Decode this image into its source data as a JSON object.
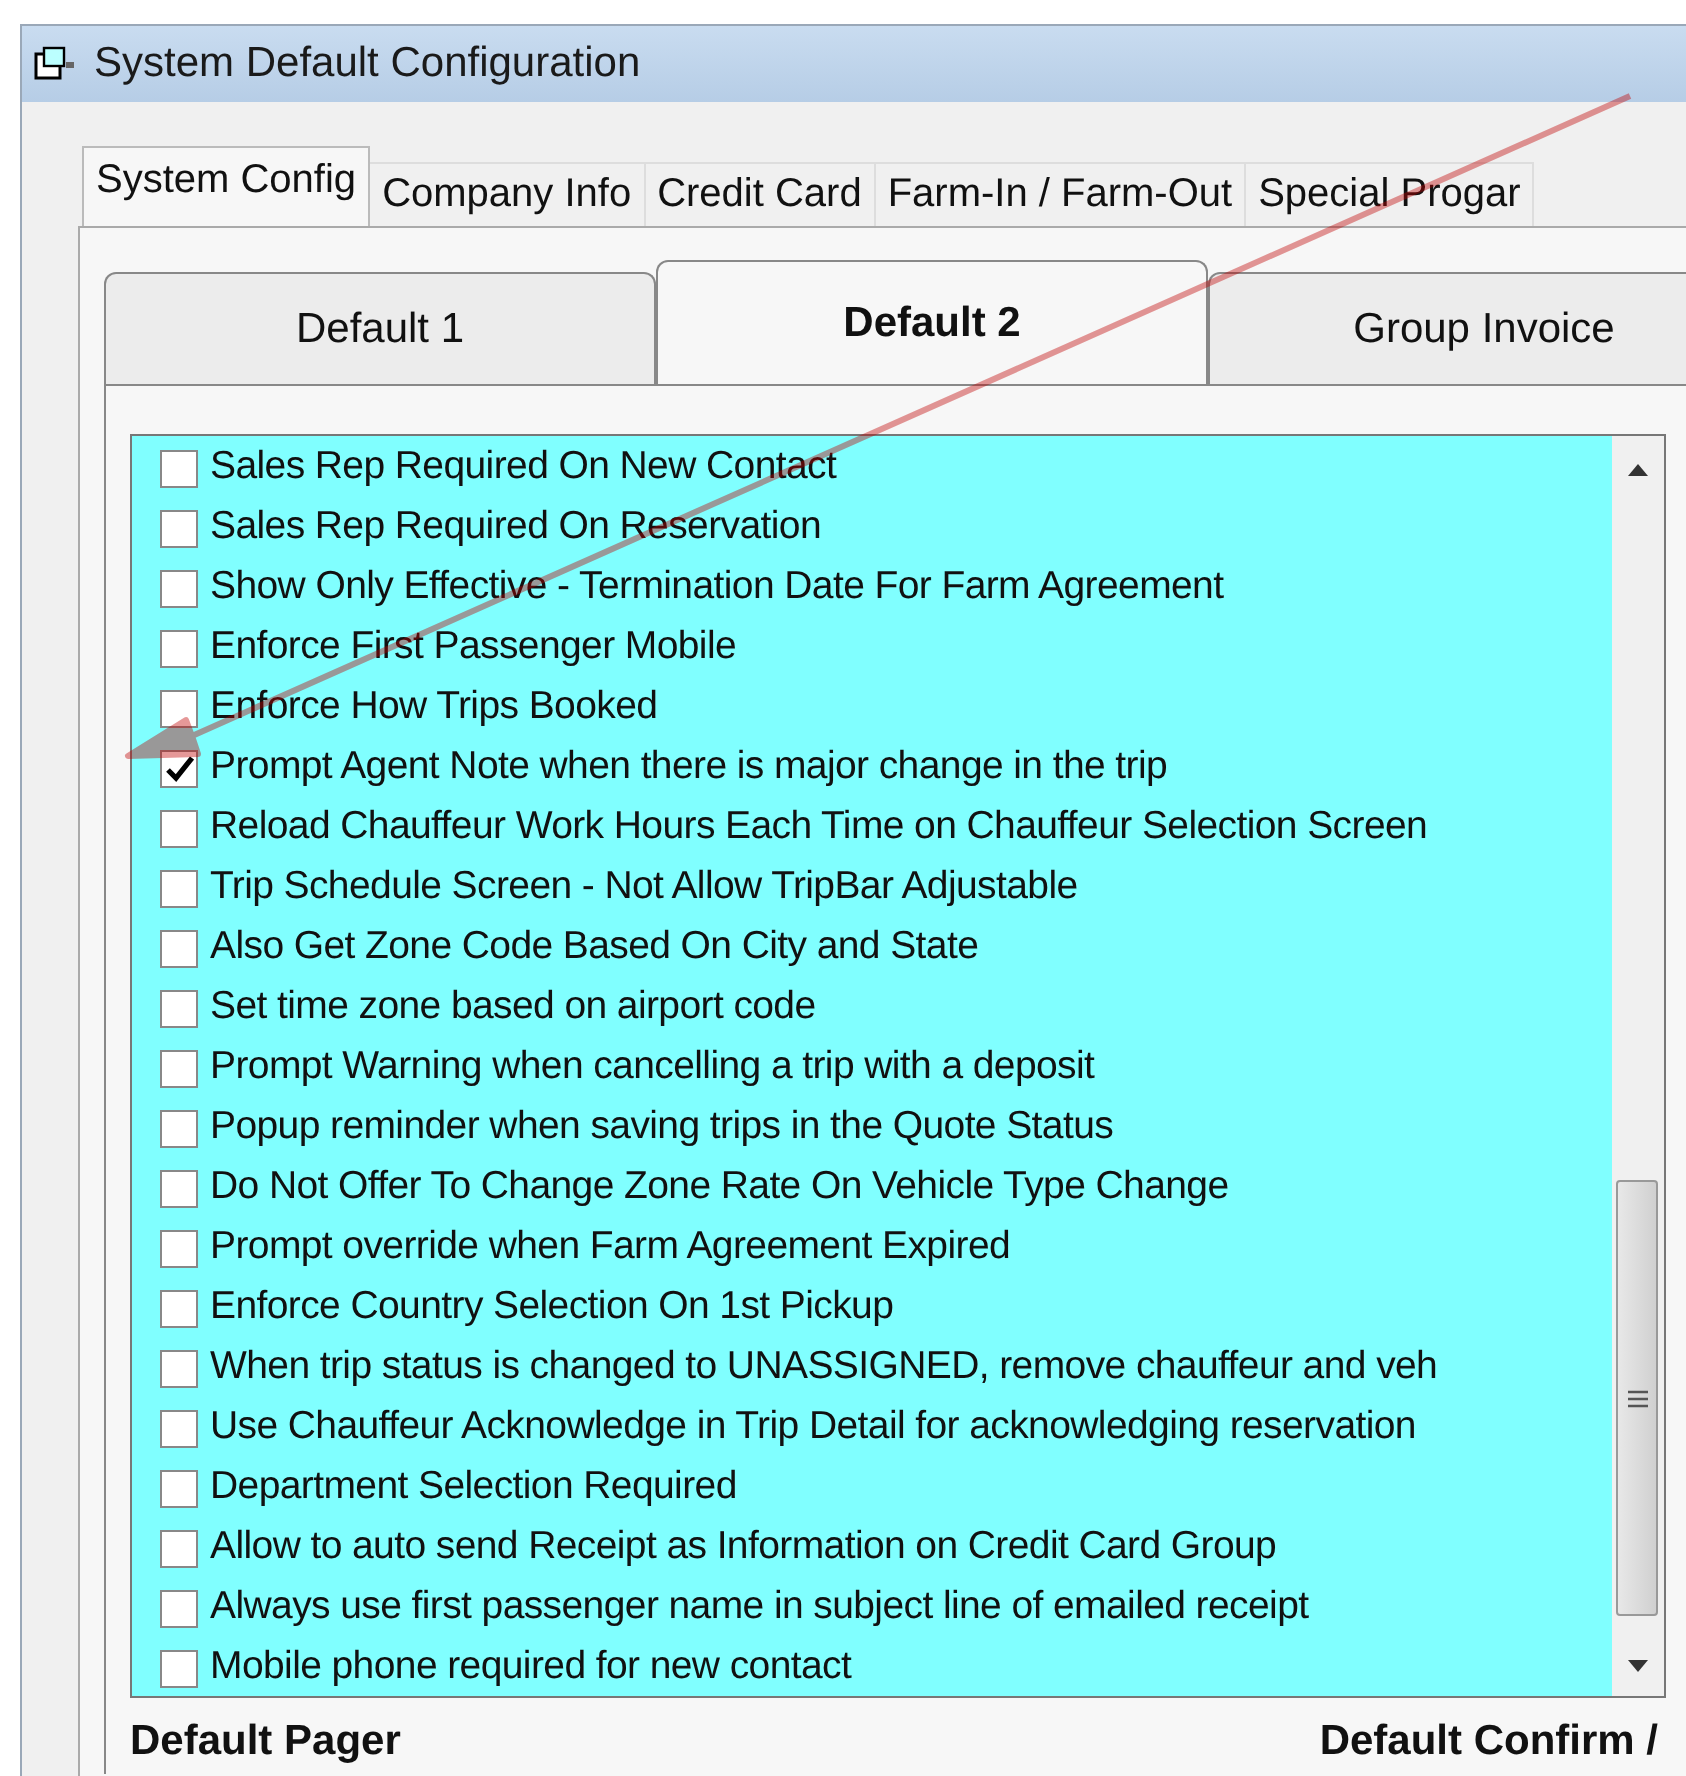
{
  "window": {
    "title": "System Default Configuration"
  },
  "tabs": [
    {
      "label": "System Config",
      "selected": true
    },
    {
      "label": "Company Info",
      "selected": false
    },
    {
      "label": "Credit Card",
      "selected": false
    },
    {
      "label": "Farm-In / Farm-Out",
      "selected": false
    },
    {
      "label": "Special Progar",
      "selected": false
    }
  ],
  "subtabs": [
    {
      "label": "Default 1",
      "selected": false
    },
    {
      "label": "Default 2",
      "selected": true
    },
    {
      "label": "Group Invoice",
      "selected": false
    }
  ],
  "options": [
    {
      "label": "Sales Rep Required On New Contact",
      "checked": false
    },
    {
      "label": "Sales Rep Required On Reservation",
      "checked": false
    },
    {
      "label": "Show Only Effective - Termination Date For Farm Agreement",
      "checked": false
    },
    {
      "label": "Enforce First Passenger Mobile",
      "checked": false
    },
    {
      "label": "Enforce How Trips Booked",
      "checked": false
    },
    {
      "label": "Prompt Agent Note when there is major change in the trip",
      "checked": true
    },
    {
      "label": "Reload Chauffeur Work Hours Each Time on Chauffeur Selection Screen",
      "checked": false
    },
    {
      "label": "Trip Schedule Screen - Not Allow TripBar Adjustable",
      "checked": false
    },
    {
      "label": "Also Get Zone Code Based On City and State",
      "checked": false
    },
    {
      "label": "Set time zone based on airport code",
      "checked": false
    },
    {
      "label": "Prompt Warning when cancelling a trip with a deposit",
      "checked": false
    },
    {
      "label": "Popup reminder when saving trips in the Quote Status",
      "checked": false
    },
    {
      "label": "Do Not Offer To Change Zone Rate On Vehicle Type Change",
      "checked": false
    },
    {
      "label": "Prompt override when Farm Agreement Expired",
      "checked": false
    },
    {
      "label": "Enforce Country Selection On 1st Pickup",
      "checked": false
    },
    {
      "label": "When trip status is changed to UNASSIGNED, remove chauffeur and veh",
      "checked": false
    },
    {
      "label": "Use Chauffeur Acknowledge in Trip Detail for acknowledging reservation",
      "checked": false
    },
    {
      "label": "Department Selection Required",
      "checked": false
    },
    {
      "label": "Allow to auto send Receipt as Information on Credit Card Group",
      "checked": false
    },
    {
      "label": "Always use first passenger name in subject line of emailed receipt",
      "checked": false
    },
    {
      "label": "Mobile phone required for new contact",
      "checked": false
    }
  ],
  "groups": [
    "Default Pager",
    "Default Confirm /"
  ]
}
